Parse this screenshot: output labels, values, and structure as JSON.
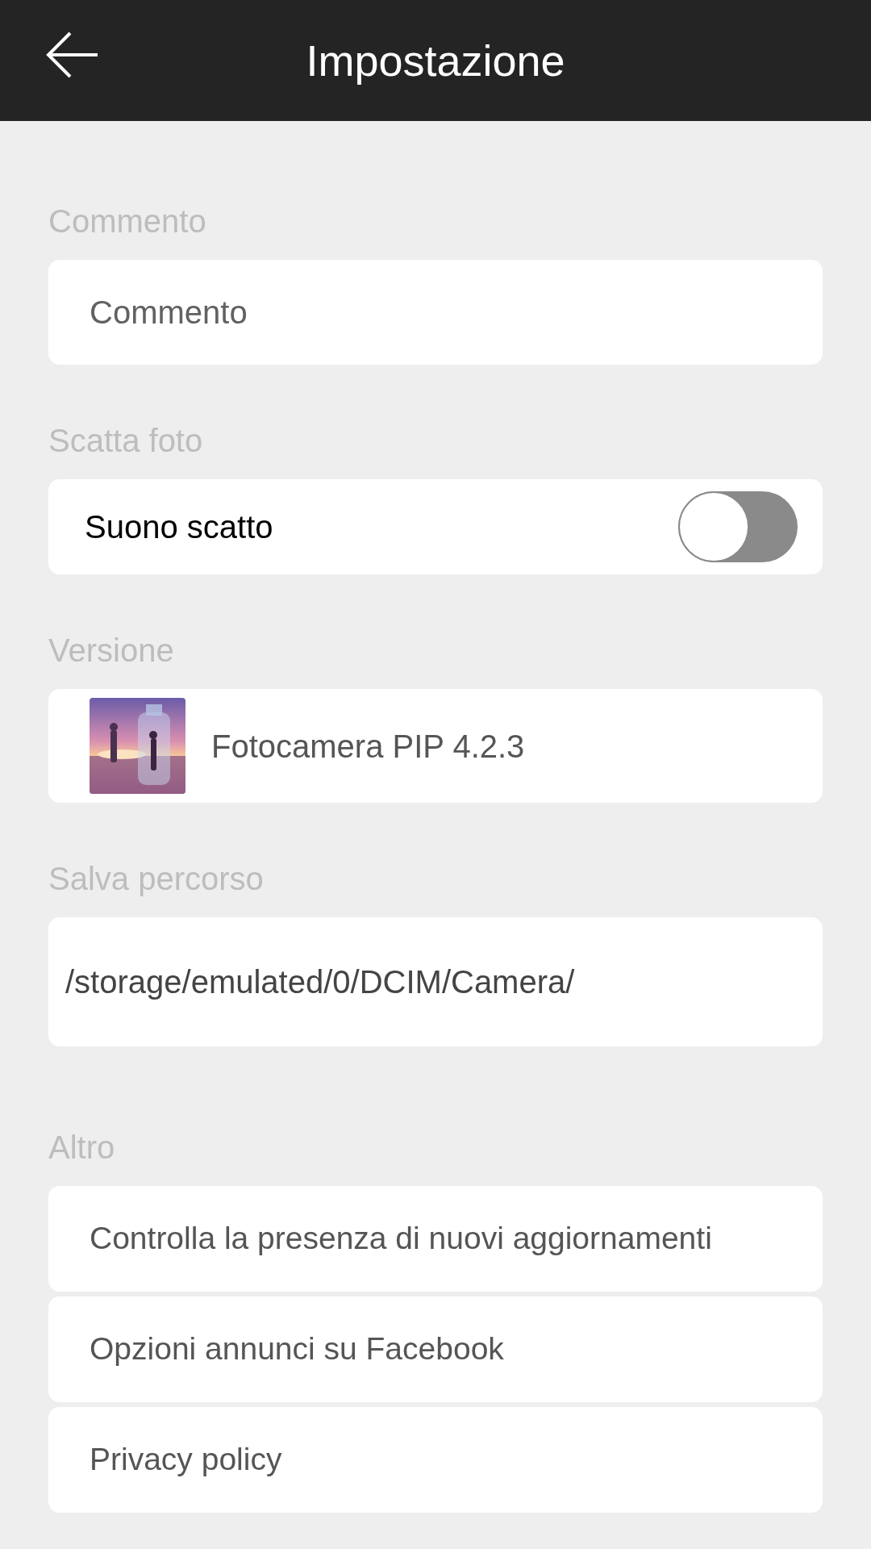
{
  "app_bar": {
    "title": "Impostazione"
  },
  "sections": [
    {
      "header": "Commento",
      "items": [
        {
          "kind": "field",
          "placeholder": "Commento"
        }
      ]
    },
    {
      "header": "Scatta foto",
      "items": [
        {
          "kind": "toggle",
          "label": "Suono scatto",
          "on": false
        }
      ]
    },
    {
      "header": "Versione",
      "items": [
        {
          "kind": "app",
          "label": "Fotocamera PIP 4.2.3"
        }
      ]
    },
    {
      "header": "Salva percorso",
      "items": [
        {
          "kind": "path",
          "label": "/storage/emulated/0/DCIM/Camera/"
        }
      ]
    },
    {
      "header": "Altro",
      "items": [
        {
          "kind": "link",
          "label": "Controlla la presenza di nuovi aggiornamenti"
        },
        {
          "kind": "link",
          "label": "Opzioni annunci su Facebook"
        },
        {
          "kind": "link",
          "label": "Privacy policy"
        }
      ]
    }
  ]
}
